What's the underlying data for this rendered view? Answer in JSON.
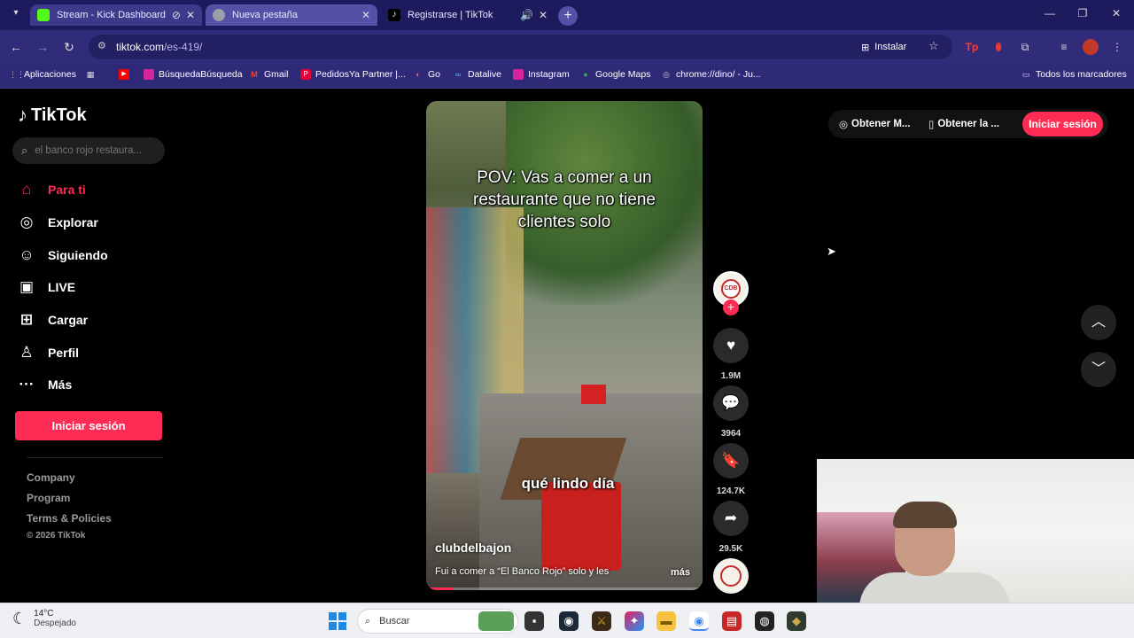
{
  "browser": {
    "tabs": [
      {
        "title": "Stream - Kick Dashboard",
        "favicon_color": "#53fc18"
      },
      {
        "title": "Nueva pestaña",
        "favicon_color": "#9aa0a6"
      },
      {
        "title": "Registrarse | TikTok",
        "favicon_color": "#000000"
      }
    ],
    "url_host": "tiktok.com",
    "url_path": "/es-419/",
    "install_label": "Instalar",
    "bookmarks": [
      {
        "label": "Aplicaciones",
        "icon": "apps-grid-icon"
      },
      {
        "label": "",
        "icon": "grid-icon"
      },
      {
        "label": "",
        "icon": "youtube-icon"
      },
      {
        "label": "BúsquedaBúsqueda",
        "icon": "instagram-icon"
      },
      {
        "label": "Gmail",
        "icon": "gmail-icon"
      },
      {
        "label": "PedidosYa Partner |...",
        "icon": "pedidosya-icon"
      },
      {
        "label": "Go",
        "icon": "go-icon"
      },
      {
        "label": "Datalive",
        "icon": "datalive-icon"
      },
      {
        "label": "Instagram",
        "icon": "instagram-icon"
      },
      {
        "label": "Google Maps",
        "icon": "maps-pin-icon"
      },
      {
        "label": "chrome://dino/ - Ju...",
        "icon": "globe-icon"
      }
    ],
    "all_bookmarks": "Todos los marcadores"
  },
  "tiktok": {
    "brand": "TikTok",
    "search_placeholder": "el banco rojo restaura...",
    "nav": [
      {
        "label": "Para ti",
        "icon": "home-icon",
        "active": true
      },
      {
        "label": "Explorar",
        "icon": "compass-icon",
        "active": false
      },
      {
        "label": "Siguiendo",
        "icon": "user-follow-icon",
        "active": false
      },
      {
        "label": "LIVE",
        "icon": "live-tv-icon",
        "active": false
      },
      {
        "label": "Cargar",
        "icon": "upload-plus-icon",
        "active": false
      },
      {
        "label": "Perfil",
        "icon": "user-icon",
        "active": false
      },
      {
        "label": "Más",
        "icon": "more-dots-icon",
        "active": false
      }
    ],
    "login_label": "Iniciar sesión",
    "footer_links": [
      "Company",
      "Program",
      "Terms & Policies"
    ],
    "copyright": "© 2026 TikTok",
    "video": {
      "caption": "POV: Vas a comer a un restaurante que no tiene clientes solo",
      "subtitle": "qué lindo día",
      "username": "clubdelbajon",
      "description": "Fui a comer a “El Banco Rojo” solo y les",
      "more": "más",
      "progress": 0.1
    },
    "actions": {
      "likes": "1.9M",
      "comments": "3964",
      "saves": "124.7K",
      "shares": "29.5K"
    },
    "top_right": {
      "get_coins": "Obtener M...",
      "get_app": "Obtener la ...",
      "login": "Iniciar sesión"
    }
  },
  "taskbar": {
    "temperature": "14°C",
    "weather": "Despejado",
    "search_placeholder": "Buscar"
  }
}
